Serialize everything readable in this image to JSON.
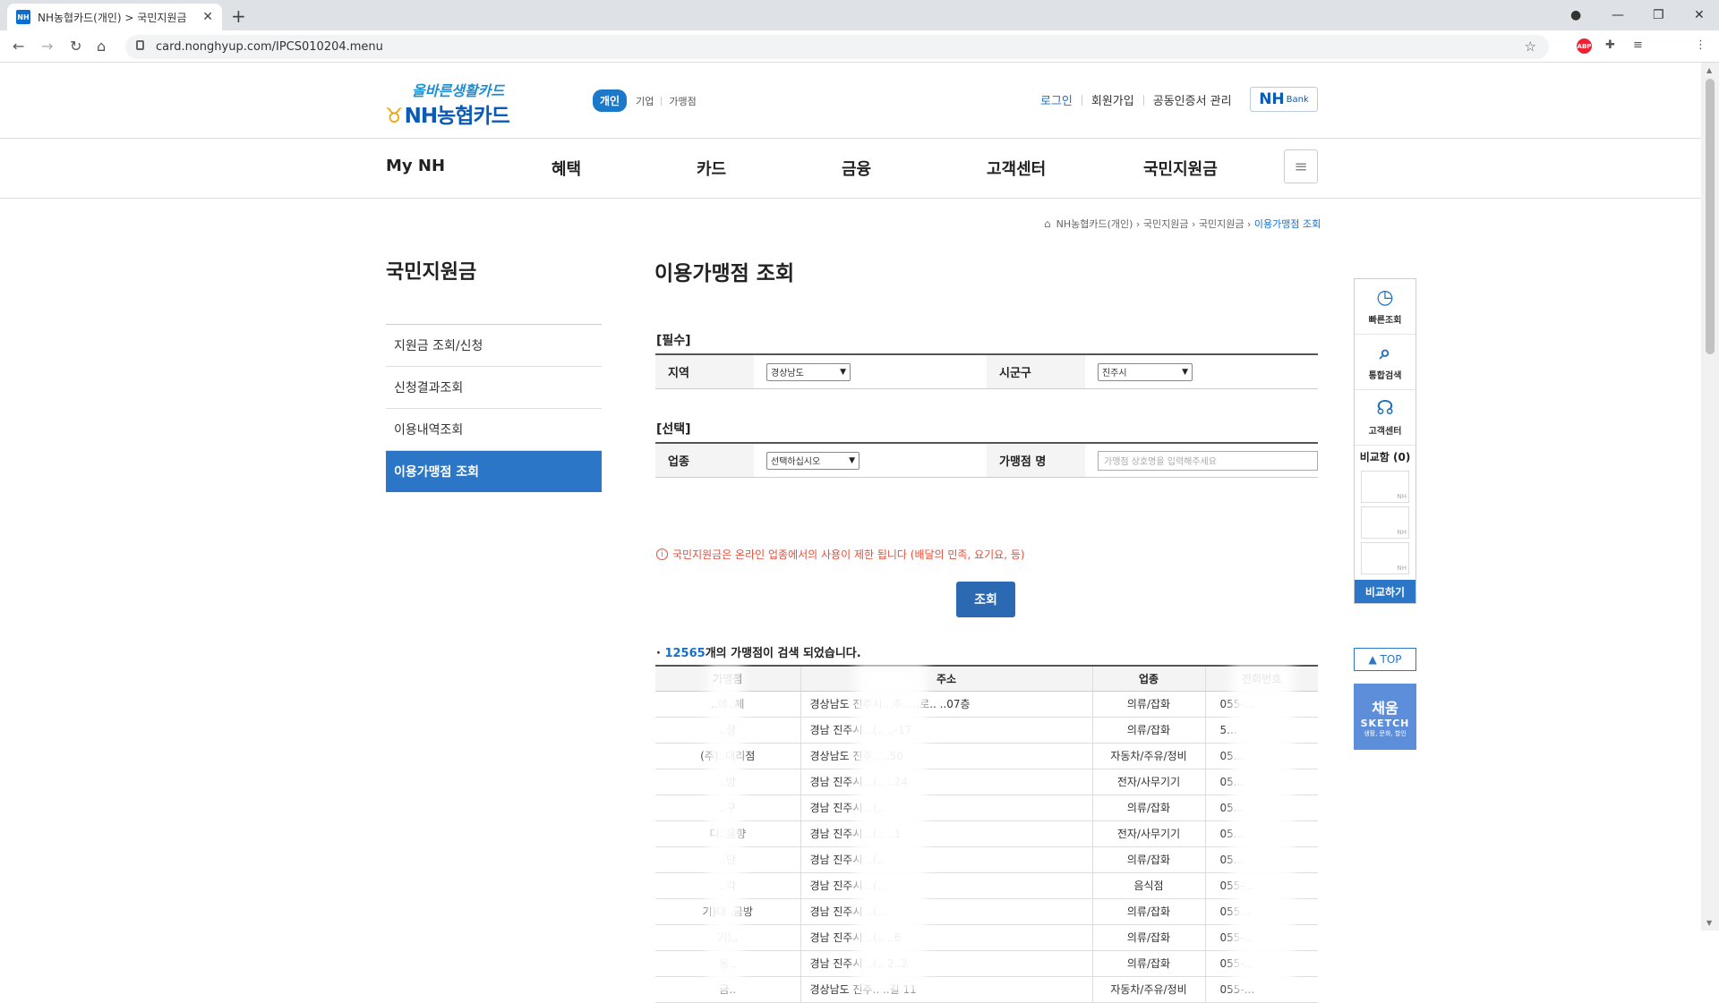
{
  "browser": {
    "tab_title": "NH농협카드(개인) > 국민지원금",
    "tab_favicon": "NH",
    "url": "card.nonghyup.com/IPCS010204.menu"
  },
  "header": {
    "logo_top": "올바른생활카드",
    "logo_main": "NH농협카드",
    "type_tabs": [
      "개인",
      "기업",
      "가맹점"
    ],
    "util_links": [
      "로그인",
      "회원가입",
      "공동인증서 관리"
    ],
    "nhbank_main": "NH",
    "nhbank_sub": "Bank"
  },
  "gnb": [
    "My NH",
    "혜택",
    "카드",
    "금융",
    "고객센터",
    "국민지원금"
  ],
  "breadcrumb": [
    "NH농협카드(개인)",
    "국민지원금",
    "국민지원금",
    "이용가맹점 조회"
  ],
  "lnb": {
    "title": "국민지원금",
    "items": [
      "지원금 조회/신청",
      "신청결과조회",
      "이용내역조회",
      "이용가맹점 조회"
    ]
  },
  "main": {
    "title": "이용가맹점 조회",
    "required_label": "[필수]",
    "optional_label": "[선택]",
    "region_label": "지역",
    "region_value": "경상남도",
    "district_label": "시군구",
    "district_value": "진주시",
    "industry_label": "업종",
    "industry_value": "선택하십시오",
    "store_label": "가맹점 명",
    "store_placeholder": "가맹점 상호명을 입력해주세요",
    "warning": "국민지원금은 온라인 업종에서의 사용이 제한 됩니다 (배달의 민족, 요기요, 등)",
    "search_button": "조회",
    "result_count": "12565",
    "result_suffix": "개의 가맹점이 검색 되었습니다.",
    "columns": [
      "가맹점",
      "주소",
      "업종",
      "전화번호"
    ],
    "rows": [
      {
        "name": "..에..체",
        "addr": "경상남도 진주시 ..주.. ..로.. ..07층",
        "type": "의류/잡화",
        "phone": "055-..."
      },
      {
        "name": "..장",
        "addr": "경남 진주시 ..(.. ..-17",
        "type": "의류/잡화",
        "phone": "5..."
      },
      {
        "name": "(주)..대리점",
        "addr": "경상남도 진주.. ..50",
        "type": "자동차/주유/정비",
        "phone": "05..."
      },
      {
        "name": "..방",
        "addr": "경남 진주시 ..(.. ..24",
        "type": "전자/사무기기",
        "phone": "05..."
      },
      {
        "name": "..구",
        "addr": "경남 진주시 ..(..",
        "type": "의류/잡화",
        "phone": "05..."
      },
      {
        "name": "디..음향",
        "addr": "경남 진주시 ..(.. ..1",
        "type": "전자/사무기기",
        "phone": "05..."
      },
      {
        "name": "..단",
        "addr": "경남 진주시 ..(..",
        "type": "의류/잡화",
        "phone": "05..."
      },
      {
        "name": "..각",
        "addr": "경남 진주시 ..(..",
        "type": "음식점",
        "phone": "055-..."
      },
      {
        "name": "기)대..금방",
        "addr": "경남 진주시 ..(..",
        "type": "의류/잡화",
        "phone": "055..."
      },
      {
        "name": "기)..",
        "addr": "경남 진주시 ..(.. ..6",
        "type": "의류/잡화",
        "phone": "055-..."
      },
      {
        "name": "동..",
        "addr": "경남 진주시 ..(.. 2..2",
        "type": "의류/잡화",
        "phone": "055-..."
      },
      {
        "name": "금..",
        "addr": "경상남도 진주.. ..길 11",
        "type": "자동차/주유/정비",
        "phone": "055-..."
      }
    ]
  },
  "quick_menu": {
    "items": [
      "빠른조회",
      "통합검색",
      "고객센터"
    ],
    "compare_label": "비교함 (0)",
    "slot_label": "NH",
    "compare_button": "비교하기",
    "top_button": "TOP",
    "banner_a": "채움",
    "banner_b": "SKETCH",
    "banner_c": "생활, 문화, 할인"
  },
  "colors": {
    "accent": "#2b76c7",
    "warning": "#e2503b",
    "link": "#1c6fc2"
  }
}
